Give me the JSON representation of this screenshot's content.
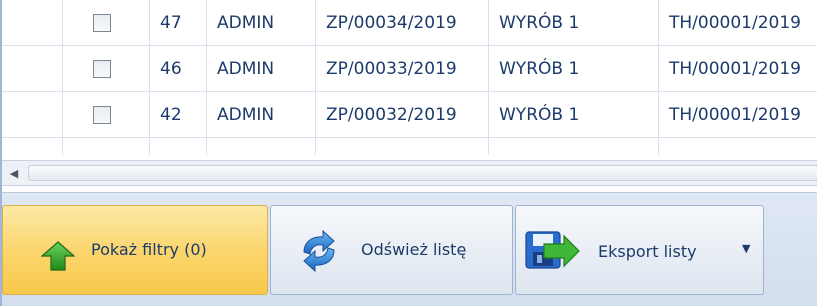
{
  "grid": {
    "rows": [
      {
        "checked": false,
        "number": "47",
        "user": "ADMIN",
        "order": "ZP/00034/2019",
        "product": "WYRÓB 1",
        "tech": "TH/00001/2019"
      },
      {
        "checked": false,
        "number": "46",
        "user": "ADMIN",
        "order": "ZP/00033/2019",
        "product": "WYRÓB 1",
        "tech": "TH/00001/2019"
      },
      {
        "checked": false,
        "number": "42",
        "user": "ADMIN",
        "order": "ZP/00032/2019",
        "product": "WYRÓB 1",
        "tech": "TH/00001/2019"
      }
    ]
  },
  "scrollbar": {
    "left_arrow": "◀"
  },
  "toolbar": {
    "show_filters_label": "Pokaż filtry (0)",
    "refresh_label": "Odśwież listę",
    "export_label": "Eksport listy",
    "export_caret": "▼"
  },
  "icons": {
    "show_filters": "green-up-arrow-icon",
    "refresh": "refresh-arrows-icon",
    "export": "floppy-export-icon"
  },
  "colors": {
    "active_button": "#fbd66e",
    "text": "#1c3b6b",
    "toolbar_bg": "#dfe8f4"
  }
}
